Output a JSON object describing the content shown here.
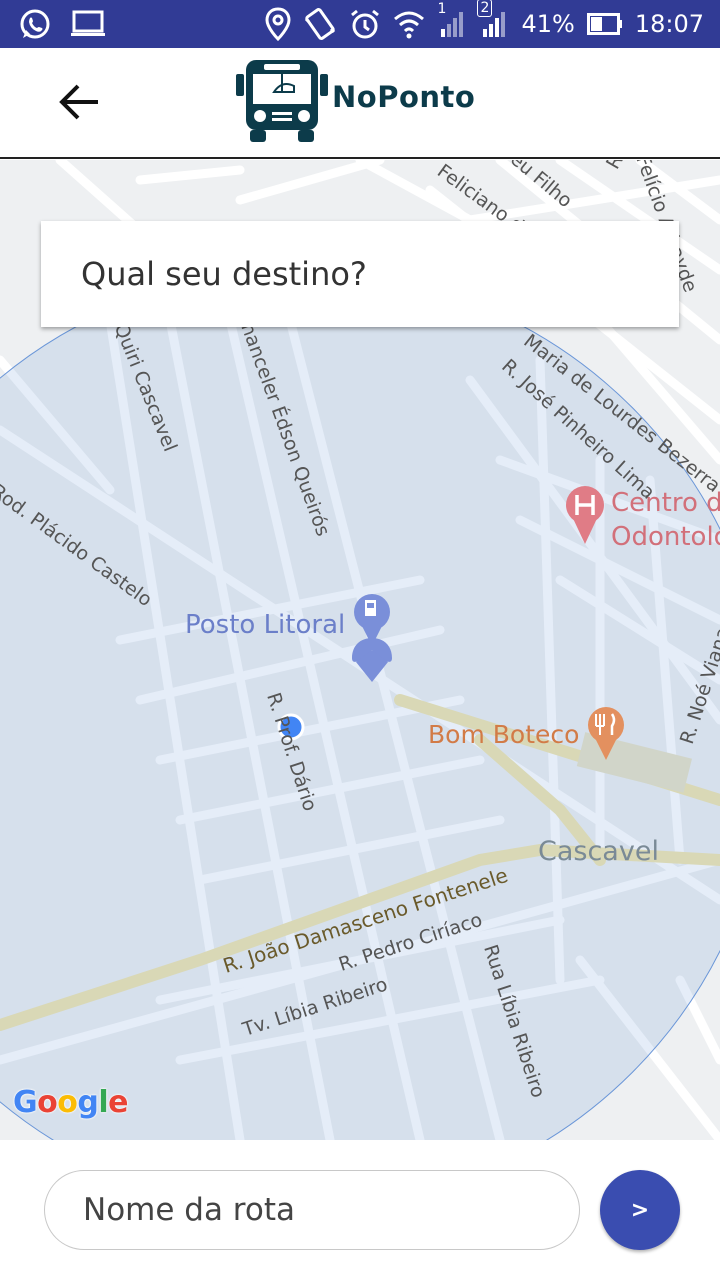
{
  "status_bar": {
    "signal_sim1": "1",
    "signal_sim2": "2",
    "battery": "41%",
    "time": "18:07"
  },
  "header": {
    "app_name": "NoPonto"
  },
  "search": {
    "placeholder": "Qual seu destino?"
  },
  "map": {
    "labels": {
      "posto": "Posto Litoral",
      "boteco": "Bom Boteco",
      "cascavel": "Cascavel",
      "centro": "Centro de",
      "centro2": "Odontoló",
      "rod_placido": "Rod. Plácido Castelo",
      "quiri": "Quiri Cascavel",
      "edson": "nanceler Édson Queirós",
      "jose_pinheiro": "R. José Pinheiro Lima",
      "maria_lourdes": "Maria de Lourdes Bezerra",
      "dario": "R. Prof. Dário",
      "joao_damasceno": "R. João Damasceno Fontenele",
      "pedro_ciriaco": "R. Pedro Ciríaco",
      "libia_tv": "Tv. Líbia Ribeiro",
      "libia_rua": "Rua Líbia Ribeiro",
      "noe": "R. Noé Viana",
      "feliciano": "Feliciano d",
      "filho": "eu Filho",
      "athayde": "Felício Athayde",
      "rp": "R. P"
    },
    "attribution": "Google"
  },
  "route": {
    "placeholder": "Nome da rota",
    "go_label": ">"
  },
  "colors": {
    "status_bar": "#313b95",
    "accent": "#3a4db0",
    "logo": "#0c3b4a"
  }
}
